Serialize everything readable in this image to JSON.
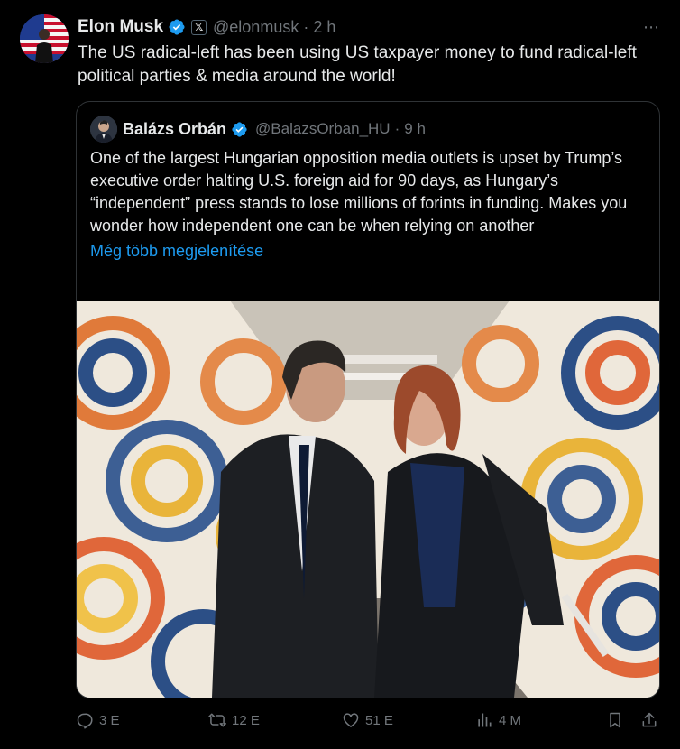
{
  "post": {
    "author_name": "Elon Musk",
    "handle": "@elonmusk",
    "separator": "·",
    "time": "2 h",
    "text": "The US radical-left has been using US taxpayer money to fund radical-left political parties & media around the world!",
    "more_icon": "⋯"
  },
  "quoted_post": {
    "author_name": "Balázs Orbán",
    "handle": "@BalazsOrban_HU",
    "separator": "·",
    "time": "9 h",
    "text": "One of the largest Hungarian opposition media outlets is upset by Trump’s executive order halting U.S. foreign aid for 90 days, as Hungary’s “independent” press stands to lose millions of forints in funding. Makes you wonder how independent one can be when relying on another",
    "show_more": "Még több megjelenítése"
  },
  "actions": {
    "replies": "3 E",
    "reposts": "12 E",
    "likes": "51 E",
    "views": "4 M"
  },
  "colors": {
    "background": "#000000",
    "text": "#e7e9ea",
    "secondary": "#71767b",
    "accent": "#1d9bf0",
    "border": "#2f3336"
  }
}
